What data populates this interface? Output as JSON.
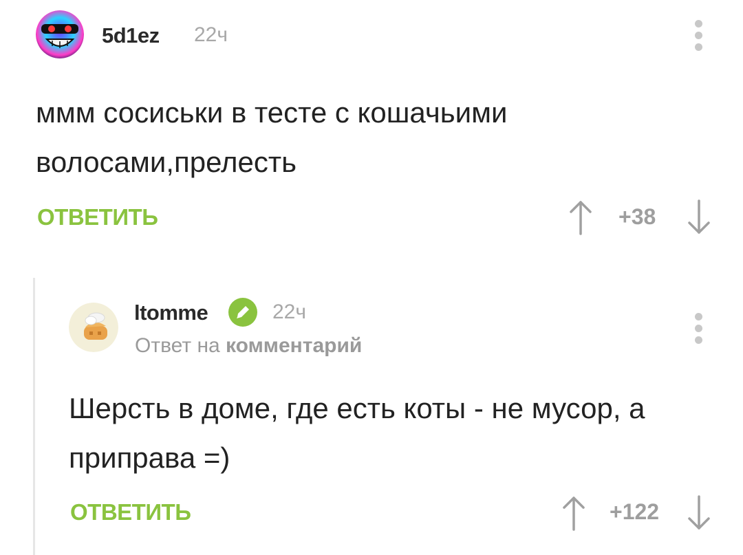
{
  "comments": [
    {
      "username": "5d1ez",
      "time": "22ч",
      "text": "ммм сосиськи в тесте с кошачьими волосами,прелесть",
      "reply_label": "ОТВЕТИТЬ",
      "rating": "+38"
    },
    {
      "username": "ltomme",
      "time": "22ч",
      "reply_prefix": "Ответ на",
      "reply_link": "комментарий",
      "text": "Шерсть в доме, где есть коты - не мусор, а приправа =)",
      "reply_label": "ОТВЕТИТЬ",
      "rating": "+122"
    }
  ],
  "icons": {
    "menu": "more-vertical-icon",
    "upvote": "arrow-up-icon",
    "downvote": "arrow-down-icon",
    "verified": "pencil-badge-icon"
  },
  "colors": {
    "accent": "#8ac33f",
    "muted": "#a8a8a8",
    "text": "#222222"
  }
}
